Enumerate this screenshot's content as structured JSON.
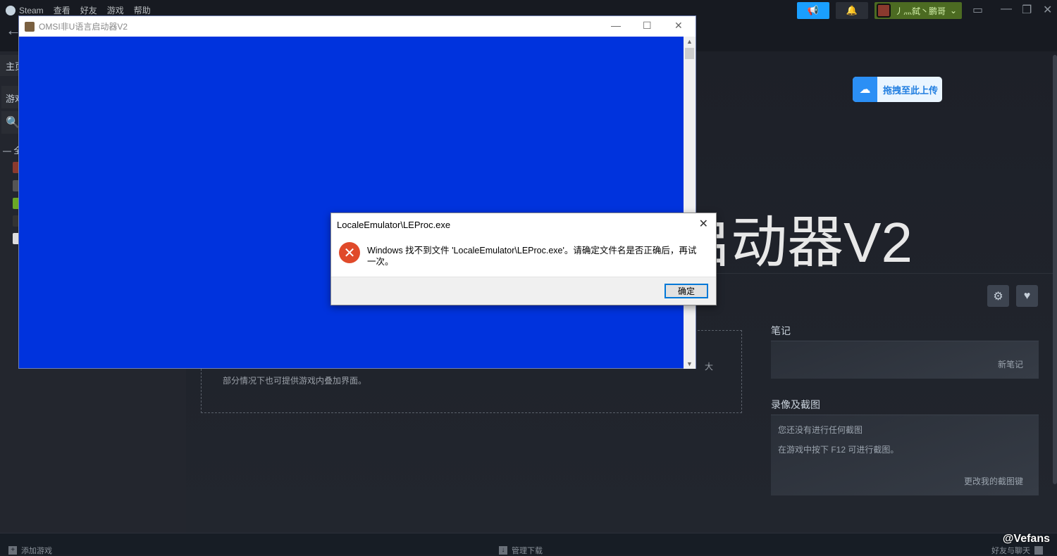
{
  "steam": {
    "menu": [
      "Steam",
      "查看",
      "好友",
      "游戏",
      "帮助"
    ],
    "user_name": "丿灬弑丶鹏哥",
    "sidebar_home": "主页",
    "sidebar_games": "游戏",
    "sidebar_all": "— 全"
  },
  "hero_title": "OMSI非U语言启动器V2",
  "baidu_upload": "拖拽至此上传",
  "overlay_text_line1": "大",
  "overlay_text_line2": "部分情况下也可提供游戏内叠加界面。",
  "notes": {
    "heading": "笔记",
    "new_note": "新笔记"
  },
  "screenshots": {
    "heading": "录像及截图",
    "empty": "您还没有进行任何截图",
    "hint": "在游戏中按下 F12 可进行截图。",
    "change_key": "更改我的截图键"
  },
  "footer": {
    "add_game": "添加游戏",
    "downloads": "管理下载",
    "friends": "好友与聊天"
  },
  "watermark": "@Vefans",
  "app_window": {
    "title": "OMSI非U语言启动器V2",
    "bg_color": "#0033dd"
  },
  "dialog": {
    "title": "LocaleEmulator\\LEProc.exe",
    "message": "Windows 找不到文件 'LocaleEmulator\\LEProc.exe'。请确定文件名是否正确后，再试一次。",
    "ok": "确定"
  }
}
